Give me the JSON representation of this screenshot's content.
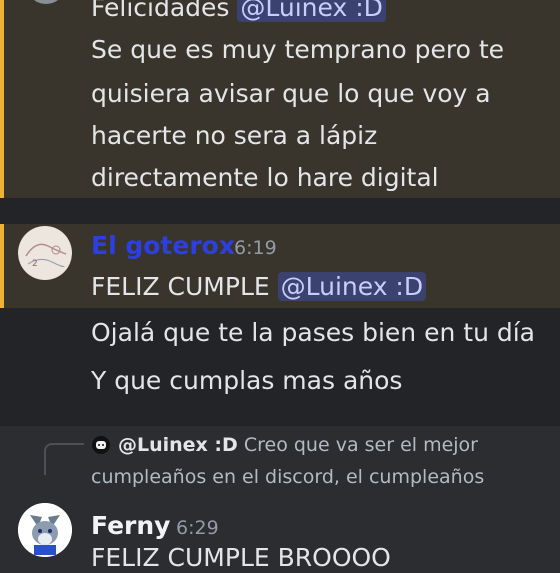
{
  "message1": {
    "lines": [
      {
        "text": "Felicidades ",
        "mention": "@Luinex :D"
      },
      {
        "text": "Se que es muy temprano pero te"
      },
      {
        "text": "quisiera avisar que lo que voy a"
      },
      {
        "text": "hacerte no sera a lápiz"
      },
      {
        "text": "directamente lo hare digital"
      }
    ]
  },
  "message2": {
    "author": "El goterox",
    "author_color": "#2d3fe0",
    "time": "6:19",
    "line1_text": "FELIZ CUMPLE ",
    "line1_mention": "@Luinex :D",
    "line2": "Ojalá que te la pases bien en tu día",
    "line3": "Y que cumplas mas años"
  },
  "message3": {
    "reply_name": "@Luinex :D",
    "reply_text_1": " Creo que va ser el mejor",
    "reply_text_2": "cumpleaños en el discord, el cumpleaños",
    "author": "Ferny",
    "time": "6:29",
    "line1": "FELIZ CUMPLE BROOOO"
  },
  "colors": {
    "background": "#2b2d31",
    "highlight": "#3a352c",
    "highlight_bar": "#f0b232",
    "mention_bg": "#3c4270",
    "mention_text": "#c9cdfb"
  },
  "icons": {
    "reply_avatar": "cat-avatar-icon",
    "ferny_avatar": "fox-avatar-icon",
    "goterox_avatar": "sketch-avatar-icon"
  }
}
